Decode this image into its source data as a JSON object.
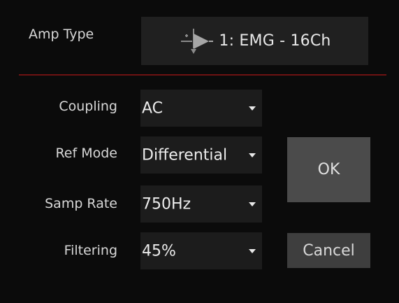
{
  "amp_type": {
    "label": "Amp Type",
    "button_text": "1: EMG - 16Ch",
    "icon": "amplifier-icon"
  },
  "settings": {
    "coupling": {
      "label": "Coupling",
      "value": "AC"
    },
    "ref_mode": {
      "label": "Ref Mode",
      "value": "Differential"
    },
    "samp_rate": {
      "label": "Samp Rate",
      "value": "750Hz"
    },
    "filtering": {
      "label": "Filtering",
      "value": "45%"
    }
  },
  "actions": {
    "ok_label": "OK",
    "cancel_label": "Cancel"
  },
  "colors": {
    "background": "#0b0b0b",
    "divider": "#6e1212",
    "ok_button": "#4b4b4b",
    "cancel_button": "#3e3e3e"
  }
}
